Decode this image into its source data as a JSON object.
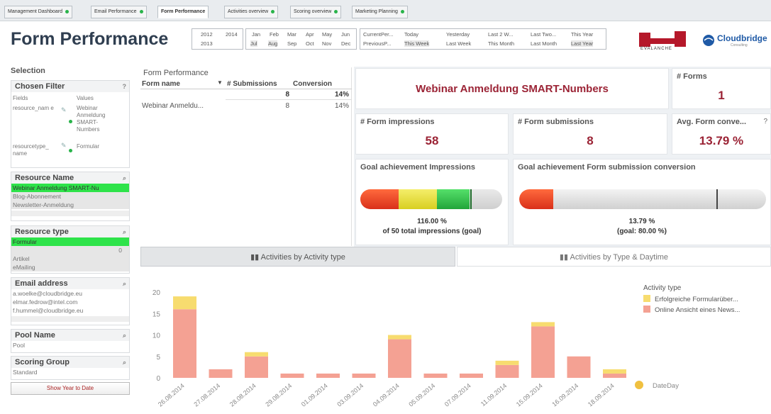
{
  "tabs": [
    {
      "label": "Management Dashboard",
      "dot": true
    },
    {
      "label": "Email Performance",
      "dot": true
    },
    {
      "label": "Form Performance",
      "dot": false,
      "active": true
    },
    {
      "label": "Activities overview",
      "dot": true
    },
    {
      "label": "Scoring overview",
      "dot": true
    },
    {
      "label": "Marketing Planning",
      "dot": true
    }
  ],
  "header": {
    "title": "Form Performance",
    "years": [
      "2012",
      "2014",
      "2013"
    ],
    "months_row1": [
      "Jan",
      "Feb",
      "Mar",
      "Apr",
      "May",
      "Jun"
    ],
    "months_row2": [
      "Jul",
      "Aug",
      "Sep",
      "Oct",
      "Nov",
      "Dec"
    ],
    "periods_row1": [
      "CurrentPer...",
      "Today",
      "Yesterday",
      "Last 2 W...",
      "Last Two...",
      "This Year"
    ],
    "periods_row2": [
      "PreviousP...",
      "This Week",
      "Last Week",
      "This Month",
      "Last Month",
      "Last Year"
    ]
  },
  "logos": {
    "evalanche": "EVALANCHE",
    "cloudbridge": "Cloudbridge",
    "cloudbridge_sub": "Consulting",
    "brand_red": "#b5182a",
    "brand_blue": "#1f5aa6"
  },
  "selection": {
    "title": "Selection",
    "chosen_filter": {
      "title": "Chosen Filter",
      "help": "?",
      "col_fields": "Fields",
      "col_values": "Values",
      "rows": [
        {
          "field": "resource_nam e",
          "value": "Webinar Anmeldung SMART-Numbers"
        },
        {
          "field": "resourcetype_ name",
          "value": "Formular"
        }
      ]
    },
    "resource_name": {
      "title": "Resource Name",
      "items": [
        "Webinar Anmeldung SMART-Nu",
        "Blog-Abonnement",
        "Newsletter-Anmeldung"
      ]
    },
    "resource_type": {
      "title": "Resource type",
      "items": [
        "Formular",
        "0",
        "Artikel",
        "eMailing"
      ]
    },
    "email_address": {
      "title": "Email address",
      "items": [
        "a.woelke@cloudbridge.eu",
        "elmar.fedrow@intel.com",
        "f.hummel@cloudbridge.eu"
      ]
    },
    "pool_name": {
      "title": "Pool Name",
      "value": "Pool"
    },
    "scoring_group": {
      "title": "Scoring Group",
      "value": "Standard"
    },
    "show_ytd": "Show Year to Date"
  },
  "form_table": {
    "title": "Form Performance",
    "columns": [
      "Form name",
      "# Submissions",
      "Conversion"
    ],
    "total": {
      "submissions": "8",
      "conversion": "14%"
    },
    "rows": [
      {
        "name": "Webinar Anmeldu...",
        "submissions": "8",
        "conversion": "14%"
      }
    ]
  },
  "kpis": {
    "selected_form": "Webinar Anmeldung SMART-Numbers",
    "forms_label": "# Forms",
    "forms_value": "1",
    "impressions_label": "# Form impressions",
    "impressions_value": "58",
    "submissions_label": "# Form submissions",
    "submissions_value": "8",
    "avg_conv_label": "Avg. Form conve...",
    "avg_conv_help": "?",
    "avg_conv_value": "13.79 %"
  },
  "gauges": {
    "impressions": {
      "title": "Goal achievement Impressions",
      "value_text": "116.00 %",
      "goal_text": "of 50 total impressions (goal)",
      "fraction": 1.16
    },
    "conversion": {
      "title": "Goal achievement Form submission conversion",
      "value_text": "13.79 %",
      "goal_text": "(goal: 80.00 %)",
      "fraction": 0.1724
    }
  },
  "chart_tabs": [
    "Activities by Activity type",
    "Activities by Type & Daytime"
  ],
  "chart_data": {
    "type": "bar",
    "stacked": true,
    "categories": [
      "26.08.2014",
      "27.08.2014",
      "28.08.2014",
      "29.08.2014",
      "01.09.2014",
      "03.09.2014",
      "04.09.2014",
      "05.09.2014",
      "07.09.2014",
      "11.09.2014",
      "15.09.2014",
      "16.09.2014",
      "18.09.2014"
    ],
    "series": [
      {
        "name": "Online Ansicht eines News...",
        "color": "#f4a193",
        "values": [
          16,
          2,
          5,
          1,
          1,
          1,
          9,
          1,
          1,
          3,
          12,
          5,
          1
        ]
      },
      {
        "name": "Erfolgreiche Formularüber...",
        "color": "#f7dc6f",
        "values": [
          3,
          0,
          1,
          0,
          0,
          0,
          1,
          0,
          0,
          1,
          1,
          0,
          1
        ]
      }
    ],
    "yticks": [
      0,
      5,
      10,
      15,
      20
    ],
    "ylim": [
      0,
      21
    ],
    "legend_title": "Activity type",
    "legend_placement": "top-right",
    "x_dim_label": "DateDay"
  }
}
